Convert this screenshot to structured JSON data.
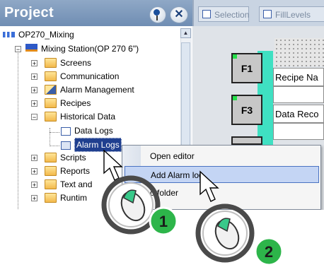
{
  "panel": {
    "title": "Project",
    "pin_icon": "pin-icon",
    "close_icon": "close-icon",
    "close_glyph": "✕"
  },
  "tree": {
    "items": [
      {
        "label": "OP270_Mixing",
        "icon": "project-icon"
      },
      {
        "label": "Mixing Station(OP 270 6\")",
        "icon": "device-icon"
      },
      {
        "label": "Screens",
        "icon": "folder-icon"
      },
      {
        "label": "Communication",
        "icon": "communication-icon"
      },
      {
        "label": "Alarm Management",
        "icon": "alarm-management-icon"
      },
      {
        "label": "Recipes",
        "icon": "folder-icon"
      },
      {
        "label": "Historical Data",
        "icon": "folder-icon"
      },
      {
        "label": "Data Logs",
        "icon": "data-logs-icon"
      },
      {
        "label": "Alarm Logs",
        "icon": "alarm-logs-icon"
      },
      {
        "label": "Scripts",
        "icon": "folder-icon"
      },
      {
        "label": "Reports",
        "icon": "folder-icon"
      },
      {
        "label": "Text and",
        "icon": "folder-icon"
      },
      {
        "label": "Runtim",
        "icon": "folder-icon"
      }
    ]
  },
  "tabs": [
    {
      "label": "Selection"
    },
    {
      "label": "FillLevels"
    }
  ],
  "editor": {
    "keys": [
      "F1",
      "F3"
    ],
    "fields": [
      "Recipe Na",
      "Data Reco"
    ]
  },
  "context_menu": {
    "items": [
      {
        "label": "Open editor"
      },
      {
        "label": "Add Alarm log"
      },
      {
        "label": "d folder"
      }
    ]
  },
  "callouts": {
    "step1": "1",
    "step2": "2"
  },
  "colors": {
    "header": "#7b97bb",
    "selection": "#1f3f8f",
    "menu_highlight": "#c4d5f4",
    "teal": "#3fe0c2",
    "badge": "#2db54a"
  }
}
